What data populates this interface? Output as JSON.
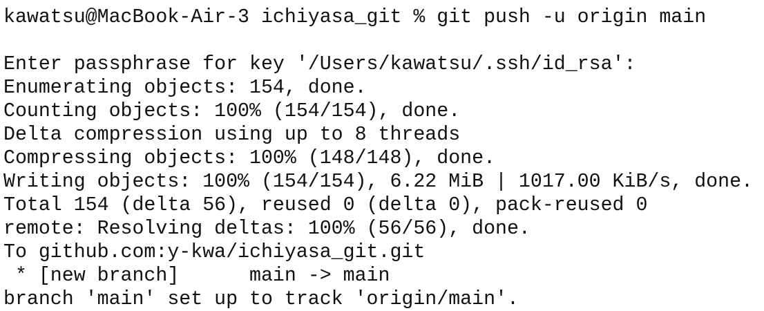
{
  "terminal": {
    "lines": [
      "kawatsu@MacBook-Air-3 ichiyasa_git % git push -u origin main",
      "",
      "Enter passphrase for key '/Users/kawatsu/.ssh/id_rsa':",
      "Enumerating objects: 154, done.",
      "Counting objects: 100% (154/154), done.",
      "Delta compression using up to 8 threads",
      "Compressing objects: 100% (148/148), done.",
      "Writing objects: 100% (154/154), 6.22 MiB | 1017.00 KiB/s, done.",
      "Total 154 (delta 56), reused 0 (delta 0), pack-reused 0",
      "remote: Resolving deltas: 100% (56/56), done.",
      "To github.com:y-kwa/ichiyasa_git.git",
      " * [new branch]      main -> main",
      "branch 'main' set up to track 'origin/main'."
    ]
  }
}
